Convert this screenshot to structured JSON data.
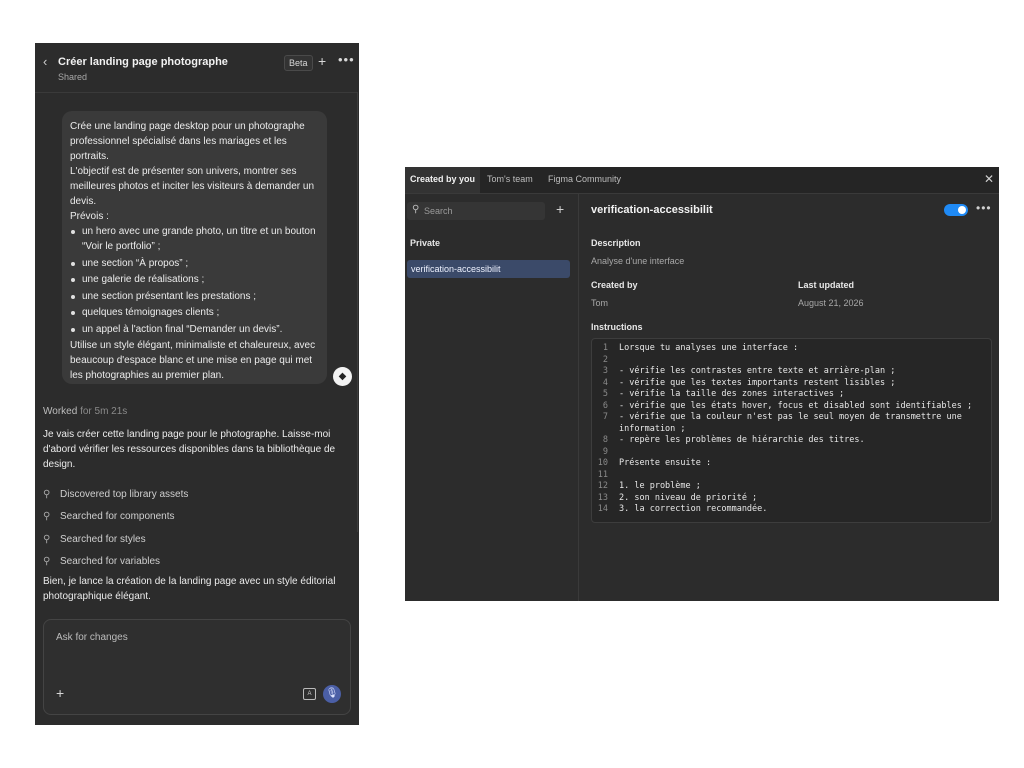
{
  "chat": {
    "header": {
      "title": "Créer landing page photographe",
      "subtitle": "Shared",
      "badge": "Beta"
    },
    "user_message": {
      "intro": "Crée une landing page desktop pour un photographe professionnel spécialisé dans les mariages et les portraits.",
      "objective": "L'objectif est de présenter son univers, montrer ses meilleures photos et inciter les visiteurs à demander un devis.",
      "list_title": "Prévois :",
      "items": [
        "un hero avec une grande photo, un titre et un bouton “Voir le portfolio” ;",
        "une section “À propos” ;",
        "une galerie de réalisations ;",
        "une section présentant les prestations ;",
        "quelques témoignages clients ;",
        "un appel à l'action final “Demander un devis”."
      ],
      "closing": "Utilise un style élégant, minimaliste et chaleureux, avec beaucoup d'espace blanc et une mise en page qui met les photographies au premier plan."
    },
    "worked_label": "Worked",
    "worked_duration": "for 5m 21s",
    "assistant_intro": "Je vais créer cette landing page pour le photographe. Laisse-moi d'abord vérifier les ressources disponibles dans ta bibliothèque de design.",
    "steps": [
      "Discovered top library assets",
      "Searched for components",
      "Searched for styles",
      "Searched for variables"
    ],
    "assistant_followup": "Bien, je lance la création de la landing page avec un style éditorial photographique élégant.",
    "composer_placeholder": "Ask for changes"
  },
  "library": {
    "tabs": [
      "Created by you",
      "Tom's team",
      "Figma Community"
    ],
    "search_placeholder": "Search",
    "section_label": "Private",
    "selected_item": "verification-accessibilit",
    "detail": {
      "name": "verification-accessibilit",
      "enabled": true,
      "description_label": "Description",
      "description": "Analyse d'une interface",
      "created_by_label": "Created by",
      "created_by": "Tom",
      "updated_label": "Last updated",
      "updated": "August 21, 2026",
      "instructions_label": "Instructions",
      "lines": [
        {
          "n": "1",
          "text": "Lorsque tu analyses une interface :"
        },
        {
          "n": "2",
          "text": ""
        },
        {
          "n": "3",
          "text": "- vérifie les contrastes entre texte et arrière-plan ;"
        },
        {
          "n": "4",
          "text": "- vérifie que les textes importants restent lisibles ;"
        },
        {
          "n": "5",
          "text": "- vérifie la taille des zones interactives ;"
        },
        {
          "n": "6",
          "text": "- vérifie que les états hover, focus et disabled sont identifiables ;"
        },
        {
          "n": "7",
          "text": "- vérifie que la couleur n'est pas le seul moyen de transmettre une information ;"
        },
        {
          "n": "8",
          "text": "- repère les problèmes de hiérarchie des titres."
        },
        {
          "n": "9",
          "text": ""
        },
        {
          "n": "10",
          "text": "Présente ensuite :"
        },
        {
          "n": "11",
          "text": ""
        },
        {
          "n": "12",
          "text": "1. le problème ;"
        },
        {
          "n": "13",
          "text": "2. son niveau de priorité ;"
        },
        {
          "n": "14",
          "text": "3. la correction recommandée."
        }
      ]
    }
  },
  "colors": {
    "panel_bg": "#2c2c2c",
    "accent_blue": "#1f8af5",
    "selected_item_bg": "#3b4a69"
  },
  "icons": [
    "chevron-left-icon",
    "plus-icon",
    "more-icon",
    "search-icon",
    "avatar-icon",
    "text-icon",
    "microphone-icon",
    "close-icon",
    "toggle-icon"
  ]
}
